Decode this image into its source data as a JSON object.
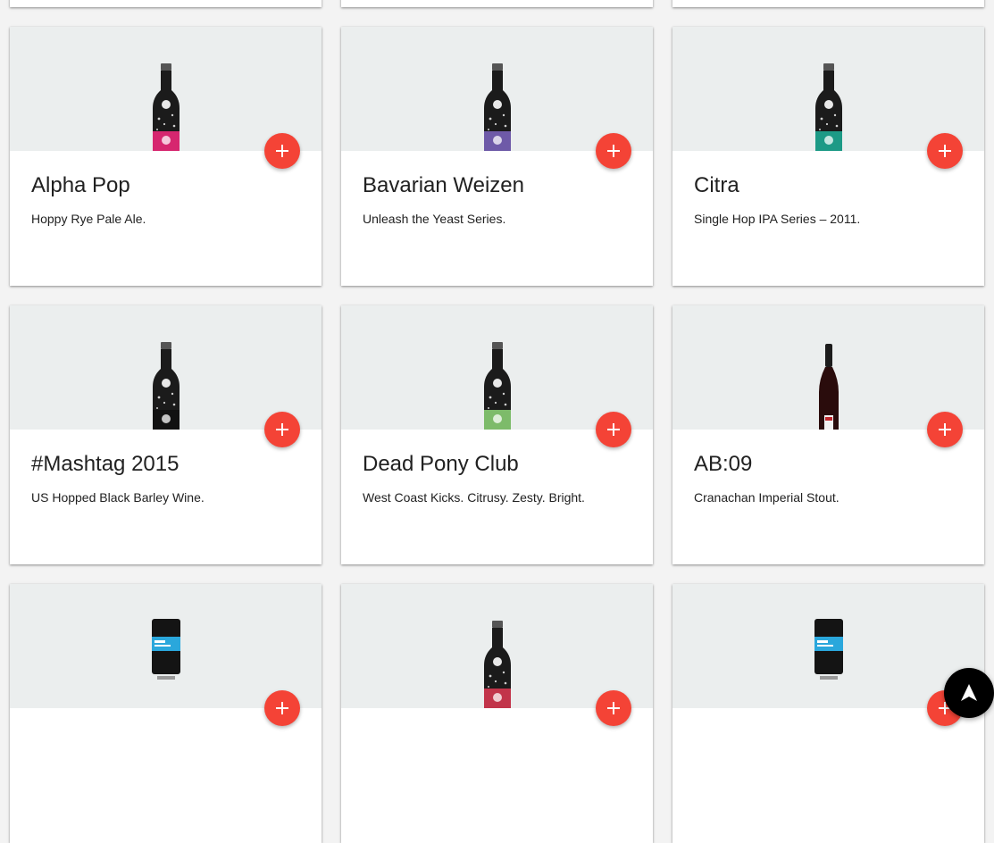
{
  "colors": {
    "fab": "#f44336",
    "media_bg": "#ebeeee",
    "page_bg": "#f3f3f3",
    "scroll_top_bg": "#000000"
  },
  "icons": {
    "add": "plus-icon",
    "scroll_top": "arrow-up-icon"
  },
  "cards": [
    {
      "title": "",
      "description": "",
      "bottle": "none",
      "label_color": "#999999"
    },
    {
      "title": "",
      "description": "",
      "bottle": "none",
      "label_color": "#999999"
    },
    {
      "title": "",
      "description": "",
      "bottle": "none",
      "label_color": "#999999"
    },
    {
      "title": "Alpha Pop",
      "description": "Hoppy Rye Pale Ale.",
      "bottle": "standard",
      "label_color": "#d6266f"
    },
    {
      "title": "Bavarian Weizen",
      "description": "Unleash the Yeast Series.",
      "bottle": "standard",
      "label_color": "#6e5aa8"
    },
    {
      "title": "Citra",
      "description": "Single Hop IPA Series – 2011.",
      "bottle": "standard",
      "label_color": "#1d9a86"
    },
    {
      "title": "#Mashtag 2015",
      "description": "US Hopped Black Barley Wine.",
      "bottle": "standard",
      "label_color": "#111111"
    },
    {
      "title": "Dead Pony Club",
      "description": "West Coast Kicks. Citrusy. Zesty. Bright.",
      "bottle": "standard",
      "label_color": "#7dbb6a"
    },
    {
      "title": "AB:09",
      "description": "Cranachan Imperial Stout.",
      "bottle": "champagne",
      "label_color": "#c0272d"
    },
    {
      "title": "",
      "description": "",
      "bottle": "can",
      "label_color": "#2aa7dc"
    },
    {
      "title": "",
      "description": "",
      "bottle": "standard",
      "label_color": "#c2344a"
    },
    {
      "title": "",
      "description": "",
      "bottle": "can",
      "label_color": "#2aa7dc"
    }
  ]
}
